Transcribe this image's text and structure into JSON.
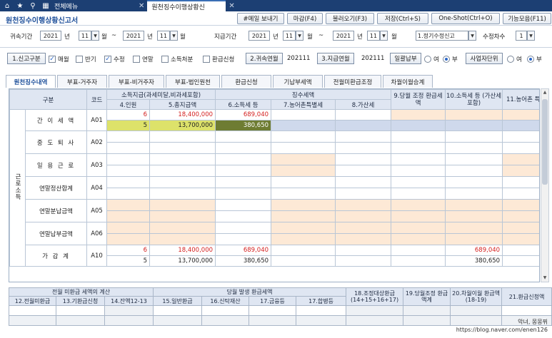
{
  "nav": {
    "icons": [
      "home-icon",
      "star-icon",
      "search-icon",
      "grid-menu-icon"
    ],
    "all_menu": "전체메뉴",
    "active_tab": "원천징수이행상황신",
    "close": "✕"
  },
  "header": {
    "title": "원천징수이행상황신고서",
    "buttons": [
      "#메일 보내기",
      "마감(F4)",
      "불러오기(F3)",
      "저장(Ctrl+S)",
      "One-Shot(Ctrl+O)",
      "기능모음(F11)"
    ]
  },
  "filters": {
    "belong_label": "귀속기간",
    "year_unit": "년",
    "month_unit": "월",
    "range_sep": "~",
    "belong_from_year": "2021",
    "belong_from_month": "11",
    "belong_to_year": "2021",
    "belong_to_month": "11",
    "pay_label": "지급기간",
    "pay_from_year": "2021",
    "pay_from_month": "11",
    "pay_to_year": "2021",
    "pay_to_month": "11",
    "report_type": "1.정기수정신고",
    "revision_label": "수정차수",
    "revision_value": "1",
    "dropdown_glyph": "▼"
  },
  "options": {
    "report_kind_btn": "1.신고구분",
    "monthly": "매월",
    "halfyear": "반기",
    "amend": "수정",
    "yearend": "연말",
    "income_disposal": "소득처분",
    "refund_apply": "환급신청",
    "belong_ym_btn": "2.귀속연월",
    "belong_ym_value": "202111",
    "pay_ym_btn": "3.지급연월",
    "pay_ym_value": "202111",
    "lump_sum_btn": "일괄납부",
    "yes": "여",
    "no": "부",
    "business_unit_btn": "사업자단위",
    "check_glyph": "✓"
  },
  "section_tabs": [
    "원천징수내역",
    "부표-거주자",
    "부표-비거주자",
    "부표-법인원천",
    "환급신청",
    "기납부세액",
    "전월미환급조정",
    "차월이월승계"
  ],
  "grid": {
    "headers": {
      "category": "구분",
      "code": "코드",
      "income_pay": "소득지급(과세미달,비과세포함)",
      "tax_collected": "징수세액",
      "c4": "4.인원",
      "c5": "5.총지급액",
      "c6": "6.소득세 등",
      "c7": "7.농어촌특별세",
      "c8": "8.가산세",
      "c9": "9.당월 조정 환급세액",
      "c10": "10.소득세 등 (가산세 포함)",
      "c11": "11.농어촌 특별세"
    },
    "side_label": "근로소득",
    "rows": [
      {
        "name": "간 이 세 액",
        "code": "A01",
        "r1": {
          "people": "6",
          "total": "18,400,000",
          "tax": "689,040"
        },
        "r2": {
          "people": "5",
          "total": "13,700,000",
          "tax": "380,650"
        }
      },
      {
        "name": "중 도 퇴 사",
        "code": "A02"
      },
      {
        "name": "일 용 근 로",
        "code": "A03"
      },
      {
        "name": "연말정산합계",
        "code": "A04"
      },
      {
        "name": "연말분납금액",
        "code": "A05"
      },
      {
        "name": "연말납부금액",
        "code": "A06"
      },
      {
        "name": "가 감 계",
        "code": "A10",
        "r1": {
          "people": "6",
          "total": "18,400,000",
          "tax": "689,040",
          "tax10": "689,040"
        },
        "r2": {
          "people": "5",
          "total": "13,700,000",
          "tax": "380,650",
          "tax10": "380,650"
        }
      }
    ]
  },
  "bottom": {
    "group1": "전월 미환급 세액의 계산",
    "group2": "당월 발생 환급세액",
    "c18": "18.조정대상환급 (14+15+16+17)",
    "c19": "19.당월조정 환급액계",
    "c20": "20.차월이월 환급액(18-19)",
    "c21": "21.환급신청액",
    "c12": "12.전월미환급",
    "c13": "13.기환급신청",
    "c14": "14.잔액12-13",
    "c15": "15.일반환급",
    "c16": "16.신탁재산",
    "c17": "17.금융등",
    "c17b": "17.합병등"
  },
  "watermark": {
    "line1": "악녀, 몽몽퓌",
    "line2": "https://blog.naver.com/enen126"
  }
}
